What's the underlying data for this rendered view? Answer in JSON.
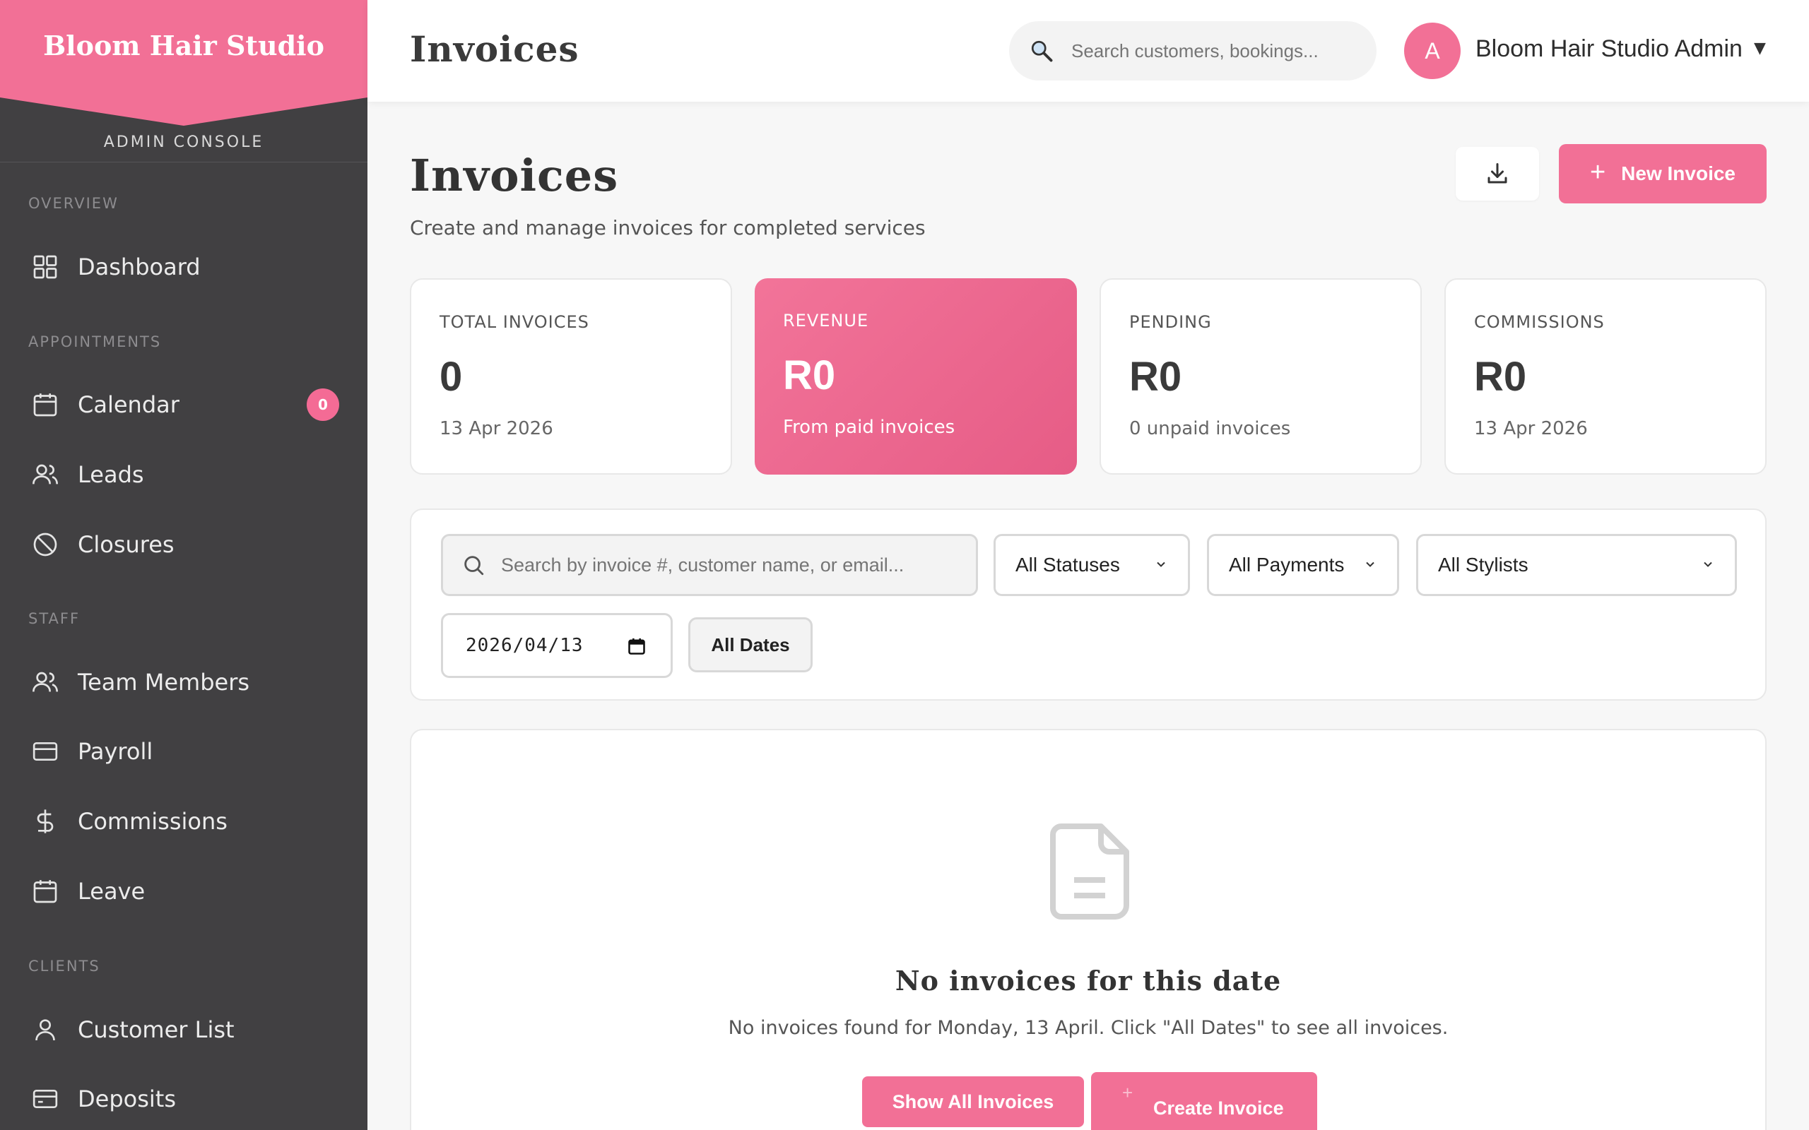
{
  "sidebar": {
    "brand": "Bloom Hair Studio",
    "console_label": "ADMIN CONSOLE",
    "sections": {
      "overview": "OVERVIEW",
      "appointments": "APPOINTMENTS",
      "staff": "STAFF",
      "clients": "CLIENTS"
    },
    "items": {
      "dashboard": "Dashboard",
      "calendar": "Calendar",
      "calendar_badge": "0",
      "leads": "Leads",
      "closures": "Closures",
      "team_members": "Team Members",
      "payroll": "Payroll",
      "commissions": "Commissions",
      "leave": "Leave",
      "customer_list": "Customer List",
      "deposits": "Deposits"
    }
  },
  "topbar": {
    "title": "Invoices",
    "search_placeholder": "Search customers, bookings...",
    "avatar_initial": "A",
    "user_name": "Bloom Hair Studio Admin",
    "caret": "▼"
  },
  "header": {
    "title": "Invoices",
    "subtitle": "Create and manage invoices for completed services",
    "new_button": "New Invoice",
    "new_button_icon": "+"
  },
  "stats": [
    {
      "label": "TOTAL INVOICES",
      "value": "0",
      "note": "13 Apr 2026"
    },
    {
      "label": "REVENUE",
      "value": "R0",
      "note": "From paid invoices"
    },
    {
      "label": "PENDING",
      "value": "R0",
      "note": "0 unpaid invoices"
    },
    {
      "label": "COMMISSIONS",
      "value": "R0",
      "note": "13 Apr 2026"
    }
  ],
  "filters": {
    "search_placeholder": "Search by invoice #, customer name, or email...",
    "status": "All Statuses",
    "payment": "All Payments",
    "stylist": "All Stylists",
    "date": "2026/04/13",
    "all_dates": "All Dates"
  },
  "empty": {
    "title": "No invoices for this date",
    "text": "No invoices found for Monday, 13 April. Click \"All Dates\" to see all invoices.",
    "show_all": "Show All Invoices",
    "create_icon": "+",
    "create": "Create Invoice"
  },
  "colors": {
    "accent": "#f27096",
    "sidebar_bg": "#414042"
  }
}
